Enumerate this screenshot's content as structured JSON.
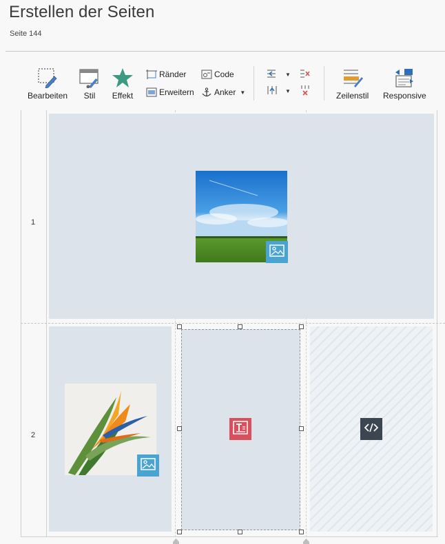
{
  "page": {
    "title": "Erstellen der Seiten",
    "subtitle": "Seite 144"
  },
  "toolbar": {
    "edit_label": "Bearbeiten",
    "style_label": "Stil",
    "effect_label": "Effekt",
    "borders_label": "Ränder",
    "expand_label": "Erweitern",
    "code_label": "Code",
    "anchor_label": "Anker",
    "rowstyle_label": "Zeilenstil",
    "responsive_label": "Responsive"
  },
  "grid": {
    "row_numbers": [
      "1",
      "2"
    ]
  },
  "colors": {
    "accent_image": "#4aa4d2",
    "accent_text": "#d94f5c",
    "accent_code": "#3b4650",
    "cell_bg": "#dce3ea",
    "effect_star": "#3c9a83"
  },
  "icons": {
    "edit": "dashed-select-pencil-icon",
    "style": "window-brush-icon",
    "effect": "star-icon",
    "borders": "borders-icon",
    "expand": "expand-icon",
    "code": "code-icon",
    "anchor": "anchor-icon",
    "rowstyle": "row-style-icon",
    "responsive": "responsive-icon"
  }
}
